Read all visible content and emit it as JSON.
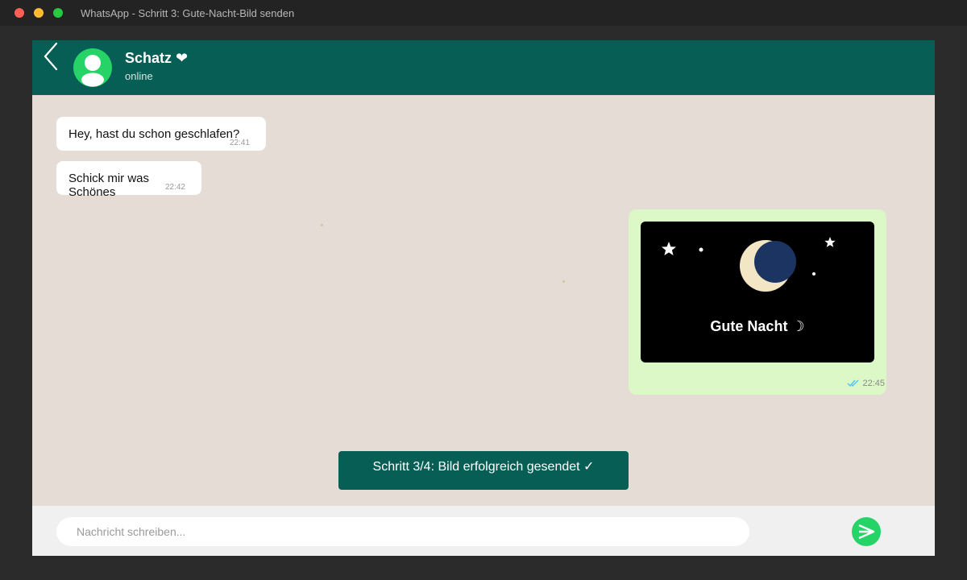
{
  "window": {
    "title": "WhatsApp - Schritt 3: Gute-Nacht-Bild senden"
  },
  "header": {
    "contact_name": "Schatz ❤",
    "status": "online"
  },
  "messages": [
    {
      "direction": "incoming",
      "text": "Hey, hast du schon geschlafen?",
      "time": "22:41"
    },
    {
      "direction": "incoming",
      "text": "Schick mir was Schönes",
      "time": "22:42"
    },
    {
      "direction": "outgoing",
      "type": "image",
      "caption": "Gute Nacht ☽",
      "time": "22:45",
      "read_status": "read"
    }
  ],
  "step_banner": {
    "text": "Schritt 3/4: Bild erfolgreich gesendet ✓"
  },
  "composer": {
    "placeholder": "Nachricht schreiben..."
  },
  "colors": {
    "header_bg": "#075e54",
    "chat_bg": "#e5ddd5",
    "outgoing_bubble": "#dcf8c6",
    "incoming_bubble": "#ffffff",
    "accent_green": "#25d366",
    "read_check": "#4fc3f7"
  },
  "icons": {
    "back": "chevron-left-icon",
    "avatar": "user-silhouette-icon",
    "read_receipt": "double-check-icon",
    "send": "send-arrow-icon",
    "moon": "crescent-moon-icon",
    "star": "star-icon"
  }
}
